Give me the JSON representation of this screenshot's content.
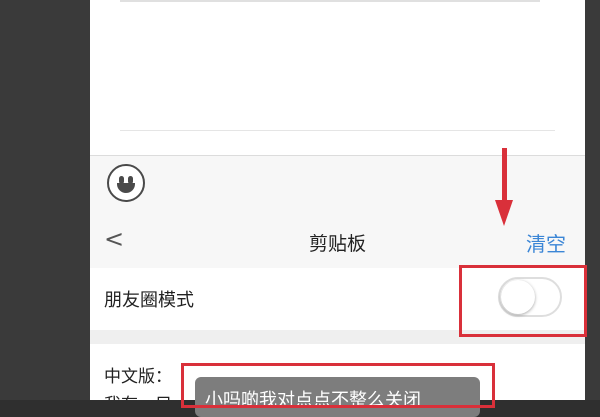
{
  "keyboard": {
    "emoji_icon": "smiley-face"
  },
  "clipboard": {
    "back_icon": "chevron-left",
    "back_label": "<",
    "title": "剪贴板",
    "clear_label": "清空",
    "clear_color": "#3b86d6"
  },
  "moments_mode": {
    "label": "朋友圈模式",
    "toggle_on": false
  },
  "content": {
    "line1": "中文版：",
    "line2": "我有一只"
  },
  "toast": {
    "text": "小吗啲我对点点不整么关闭"
  },
  "annotations": {
    "highlight_color": "#d9303a"
  }
}
